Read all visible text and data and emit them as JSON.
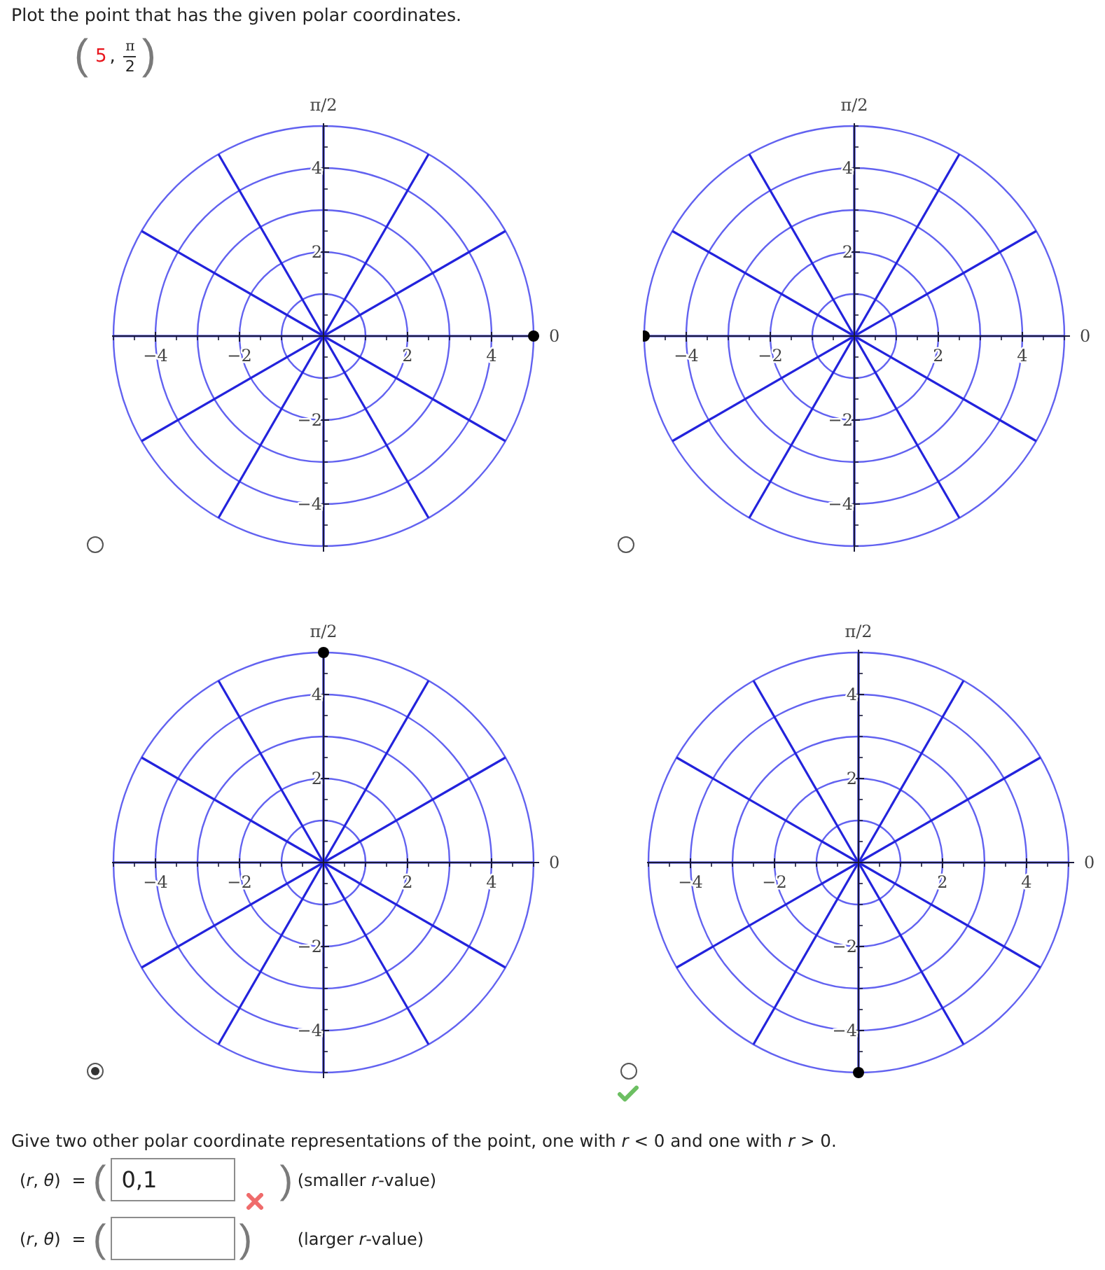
{
  "question": {
    "prompt": "Plot the point that has the given polar coordinates.",
    "given_point": {
      "open": "(",
      "r": "5",
      "separator": ",",
      "theta_numerator": "π",
      "theta_denominator": "2",
      "close": ")"
    }
  },
  "choices": {
    "correct": true,
    "options": [
      {
        "selected": false,
        "chart_data": {
          "type": "scatter",
          "xlim": [
            -5,
            5
          ],
          "ylim": [
            -5,
            5
          ],
          "xticks": [
            {
              "value": -4,
              "label": "−4"
            },
            {
              "value": -2,
              "label": "−2"
            },
            {
              "value": 2,
              "label": "2"
            },
            {
              "value": 4,
              "label": "4"
            }
          ],
          "yticks": [
            {
              "value": -4,
              "label": "−4"
            },
            {
              "value": -2,
              "label": "−2"
            },
            {
              "value": 2,
              "label": "2"
            },
            {
              "value": 4,
              "label": "4"
            }
          ],
          "x": [
            5
          ],
          "values": [
            0
          ],
          "annotations": [
            "π/2",
            "0"
          ]
        }
      },
      {
        "selected": false,
        "chart_data": {
          "type": "scatter",
          "xlim": [
            -5,
            5
          ],
          "ylim": [
            -5,
            5
          ],
          "xticks": [
            {
              "value": -4,
              "label": "−4"
            },
            {
              "value": -2,
              "label": "−2"
            },
            {
              "value": 2,
              "label": "2"
            },
            {
              "value": 4,
              "label": "4"
            }
          ],
          "yticks": [
            {
              "value": -4,
              "label": "−4"
            },
            {
              "value": -2,
              "label": "−2"
            },
            {
              "value": 2,
              "label": "2"
            },
            {
              "value": 4,
              "label": "4"
            }
          ],
          "x": [
            -5
          ],
          "values": [
            0
          ],
          "annotations": [
            "π/2",
            "0"
          ]
        }
      },
      {
        "selected": true,
        "chart_data": {
          "type": "scatter",
          "xlim": [
            -5,
            5
          ],
          "ylim": [
            -5,
            5
          ],
          "xticks": [
            {
              "value": -4,
              "label": "−4"
            },
            {
              "value": -2,
              "label": "−2"
            },
            {
              "value": 2,
              "label": "2"
            },
            {
              "value": 4,
              "label": "4"
            }
          ],
          "yticks": [
            {
              "value": -4,
              "label": "−4"
            },
            {
              "value": -2,
              "label": "−2"
            },
            {
              "value": 2,
              "label": "2"
            },
            {
              "value": 4,
              "label": "4"
            }
          ],
          "x": [
            0
          ],
          "values": [
            5
          ],
          "annotations": [
            "π/2",
            "0"
          ]
        }
      },
      {
        "selected": false,
        "chart_data": {
          "type": "scatter",
          "xlim": [
            -5,
            5
          ],
          "ylim": [
            -5,
            5
          ],
          "xticks": [
            {
              "value": -4,
              "label": "−4"
            },
            {
              "value": -2,
              "label": "−2"
            },
            {
              "value": 2,
              "label": "2"
            },
            {
              "value": 4,
              "label": "4"
            }
          ],
          "yticks": [
            {
              "value": -4,
              "label": "−4"
            },
            {
              "value": -2,
              "label": "−2"
            },
            {
              "value": 2,
              "label": "2"
            },
            {
              "value": 4,
              "label": "4"
            }
          ],
          "x": [
            0
          ],
          "values": [
            -5
          ],
          "annotations": [
            "π/2",
            "0"
          ]
        }
      }
    ]
  },
  "follow_up": {
    "prompt": "Give two other polar coordinate representations of the point, one with *r* < 0 and one with *r* > 0.",
    "answers": [
      {
        "label": "(*r*, *θ*)",
        "equals": "=",
        "open": "(",
        "value": "0,1",
        "correct": false,
        "close": ")",
        "hint": "(smaller *r*-value)"
      },
      {
        "label": "(*r*, *θ*)",
        "equals": "=",
        "open": "(",
        "close": ")",
        "hint": "(larger *r*-value)"
      }
    ]
  }
}
